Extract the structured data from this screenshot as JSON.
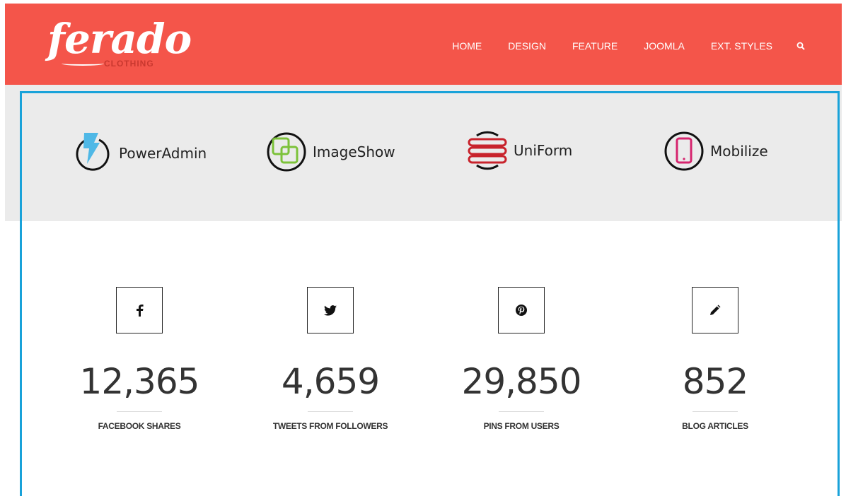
{
  "brand": {
    "name": "ferado",
    "tagline": "CLOTHING"
  },
  "nav": {
    "items": [
      "HOME",
      "DESIGN",
      "FEATURE",
      "JOOMLA",
      "EXT. STYLES"
    ],
    "search_icon": "search-icon"
  },
  "products": [
    {
      "label": "PowerAdmin",
      "icon": "lightning-icon"
    },
    {
      "label": "ImageShow",
      "icon": "overlapping-squares-icon"
    },
    {
      "label": "UniForm",
      "icon": "stacked-bars-icon"
    },
    {
      "label": "Mobilize",
      "icon": "mobile-phone-icon"
    }
  ],
  "stats": [
    {
      "value": "12,365",
      "label": "FACEBOOK SHARES",
      "icon": "facebook-icon"
    },
    {
      "value": "4,659",
      "label": "TWEETS FROM FOLLOWERS",
      "icon": "twitter-icon"
    },
    {
      "value": "29,850",
      "label": "PINS FROM USERS",
      "icon": "pinterest-icon"
    },
    {
      "value": "852",
      "label": "BLOG ARTICLES",
      "icon": "pencil-icon"
    }
  ],
  "colors": {
    "header": "#f4554a",
    "frame": "#19a2d9",
    "band": "#ebebeb"
  }
}
